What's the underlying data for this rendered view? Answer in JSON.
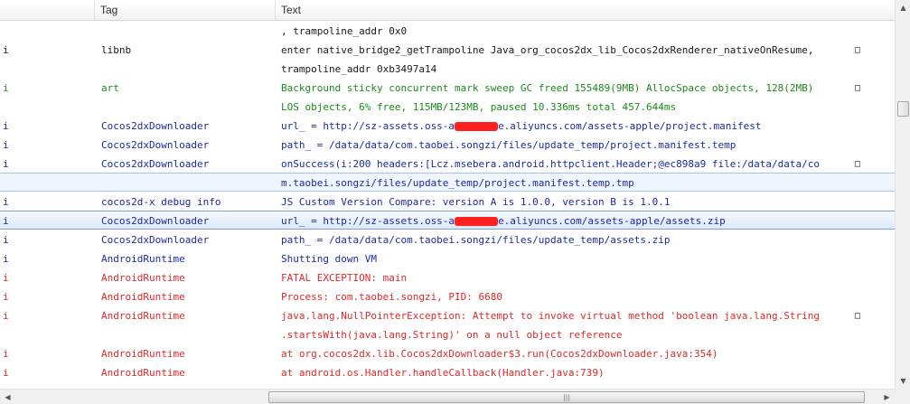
{
  "header": {
    "level": "",
    "tag": "Tag",
    "text": "Text"
  },
  "log_rows": [
    {
      "level": "",
      "tag": "",
      "text": ", trampoline_addr 0x0",
      "trunc": "",
      "color": "lvl-black",
      "state": ""
    },
    {
      "level": "i",
      "tag": "libnb",
      "text": "enter native_bridge2_getTrampoline Java_org_cocos2dx_lib_Cocos2dxRenderer_nativeOnResume,",
      "trunc": "□",
      "color": "lvl-black",
      "state": ""
    },
    {
      "level": "",
      "tag": "",
      "text": "trampoline_addr 0xb3497a14",
      "trunc": "",
      "color": "lvl-black",
      "state": ""
    },
    {
      "level": "i",
      "tag": "art",
      "text": "Background sticky concurrent mark sweep GC freed 155489(9MB) AllocSpace objects, 128(2MB)",
      "trunc": "□",
      "color": "lvl-green",
      "state": ""
    },
    {
      "level": "",
      "tag": "",
      "text": "LOS objects, 6% free, 115MB/123MB, paused 10.336ms total 457.644ms",
      "trunc": "",
      "color": "lvl-green",
      "state": ""
    },
    {
      "level": "i",
      "tag": "Cocos2dxDownloader",
      "text_pre": "url_ = http://sz-assets.oss-a",
      "text_post": "e.aliyuncs.com/assets-apple/project.manifest",
      "redact": true,
      "trunc": "",
      "color": "lvl-info",
      "state": ""
    },
    {
      "level": "i",
      "tag": "Cocos2dxDownloader",
      "text": "path_ = /data/data/com.taobei.songzi/files/update_temp/project.manifest.temp",
      "trunc": "",
      "color": "lvl-info",
      "state": ""
    },
    {
      "level": "i",
      "tag": "Cocos2dxDownloader",
      "text": "onSuccess(i:200 headers:[Lcz.msebera.android.httpclient.Header;@ec898a9 file:/data/data/co",
      "trunc": "□",
      "color": "lvl-info",
      "state": ""
    },
    {
      "level": "",
      "tag": "",
      "text": "m.taobei.songzi/files/update_temp/project.manifest.temp.tmp",
      "trunc": "",
      "color": "lvl-info",
      "state": "hl"
    },
    {
      "level": "i",
      "tag": "cocos2d-x debug info",
      "text": "JS Custom Version Compare: version A is 1.0.0, version B is 1.0.1",
      "trunc": "",
      "color": "lvl-info",
      "state": ""
    },
    {
      "level": "i",
      "tag": "Cocos2dxDownloader",
      "text_pre": "url_ = http://sz-assets.oss-a",
      "text_post": "e.aliyuncs.com/assets-apple/assets.zip",
      "redact": true,
      "trunc": "",
      "color": "lvl-info",
      "state": "sel"
    },
    {
      "level": "i",
      "tag": "Cocos2dxDownloader",
      "text": "path_ = /data/data/com.taobei.songzi/files/update_temp/assets.zip",
      "trunc": "",
      "color": "lvl-info",
      "state": ""
    },
    {
      "level": "i",
      "tag": "AndroidRuntime",
      "text": "Shutting down VM",
      "trunc": "",
      "color": "lvl-info",
      "state": ""
    },
    {
      "level": "i",
      "tag": "AndroidRuntime",
      "text": "FATAL EXCEPTION: main",
      "trunc": "",
      "color": "lvl-red",
      "state": ""
    },
    {
      "level": "i",
      "tag": "AndroidRuntime",
      "text": "Process: com.taobei.songzi, PID: 6680",
      "trunc": "",
      "color": "lvl-red",
      "state": ""
    },
    {
      "level": "i",
      "tag": "AndroidRuntime",
      "text": "java.lang.NullPointerException: Attempt to invoke virtual method 'boolean java.lang.String",
      "trunc": "□",
      "color": "lvl-red",
      "state": ""
    },
    {
      "level": "",
      "tag": "",
      "text": ".startsWith(java.lang.String)' on a null object reference",
      "trunc": "",
      "color": "lvl-red",
      "state": ""
    },
    {
      "level": "i",
      "tag": "AndroidRuntime",
      "text": "at org.cocos2dx.lib.Cocos2dxDownloader$3.run(Cocos2dxDownloader.java:354)",
      "trunc": "",
      "color": "lvl-red",
      "state": ""
    },
    {
      "level": "i",
      "tag": "AndroidRuntime",
      "text": "at android.os.Handler.handleCallback(Handler.java:739)",
      "trunc": "",
      "color": "lvl-red",
      "state": ""
    }
  ],
  "row_level_colors": {
    "lvl-black": "#1a1a1a",
    "lvl-green": "#1a8a1a",
    "lvl-info": "#1b2aa0",
    "lvl-red": "#e0282a"
  },
  "scrollbars": {
    "v_up_icon": "▲",
    "v_down_icon": "▼",
    "h_left_icon": "◀",
    "h_right_icon": "▶",
    "h_grip": "|||"
  }
}
